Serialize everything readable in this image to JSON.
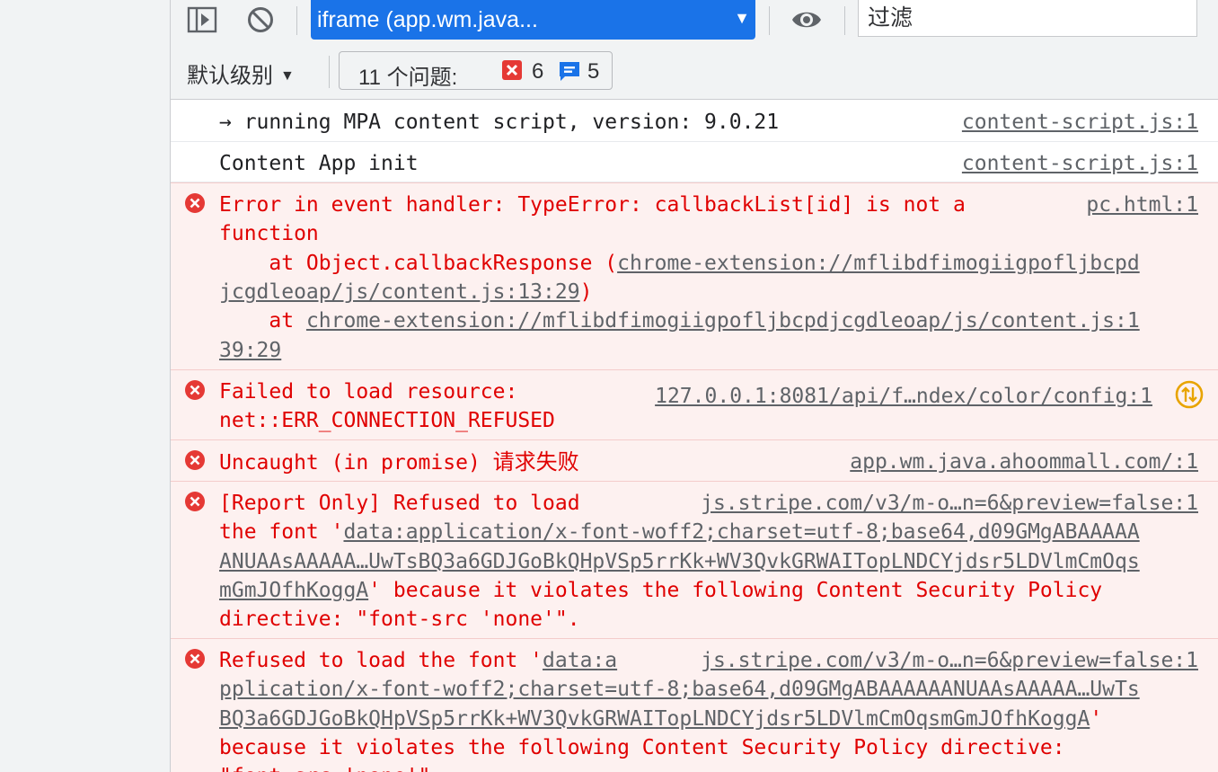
{
  "toolbar": {
    "context_select": "iframe (app.wm.java...",
    "filter_placeholder": "过滤",
    "level_dropdown": "默认级别",
    "issues_label": "11 个问题:",
    "issues_error_count": "6",
    "issues_info_count": "5"
  },
  "console": {
    "m1": {
      "text": "→ running MPA content script, version: 9.0.21",
      "source": "content-script.js:1"
    },
    "m2": {
      "text": "Content App init",
      "source": "content-script.js:1"
    },
    "m3": {
      "line1": "Error in event handler: TypeError: callbackList[id] is not a",
      "line2": "function",
      "line3_prefix": "    at Object.callbackResponse (",
      "line3_link": "chrome-extension://mflibdfimogiigpofljbcpd",
      "line4_link": "jcgdleoap/js/content.js:13:29",
      "line4_suffix": ")",
      "line5_prefix": "    at ",
      "line5_link": "chrome-extension://mflibdfimogiigpofljbcpdjcgdleoap/js/content.js:1",
      "line6_link": "39:29",
      "source": "pc.html:1"
    },
    "m4": {
      "line1": "Failed to load resource:",
      "line2": "net::ERR_CONNECTION_REFUSED",
      "source": "127.0.0.1:8081/api/f…ndex/color/config:1"
    },
    "m5": {
      "text": "Uncaught (in promise) ",
      "text_zh": "请求失败",
      "source": "app.wm.java.ahoommall.com/:1"
    },
    "m6": {
      "line1": "[Report Only] Refused to load",
      "line2_prefix": "the font '",
      "line2_link": "data:application/x-font-woff2;charset=utf-8;base64,d09GMgABAAAAA",
      "line3_link": "ANUAAsAAAAA…UwTsBQ3a6GDJGoBkQHpVSp5rrKk+WV3QvkGRWAITopLNDCYjdsr5LDVlmCmOqs",
      "line4_link": "mGmJOfhKoggA",
      "line4_suffix": "' because it violates the following Content Security Policy",
      "line5": "directive: \"font-src 'none'\".",
      "source": "js.stripe.com/v3/m-o…n=6&preview=false:1"
    },
    "m7": {
      "line1_prefix": "Refused to load the font '",
      "line1_link": "data:a",
      "line2_link": "pplication/x-font-woff2;charset=utf-8;base64,d09GMgABAAAAAANUAAsAAAAA…UwTs",
      "line3_link": "BQ3a6GDJGoBkQHpVSp5rrKk+WV3QvkGRWAITopLNDCYjdsr5LDVlmCmOqsmGmJOfhKoggA",
      "line3_suffix": "'",
      "line4": "because it violates the following Content Security Policy directive:",
      "line5": "\"font-src 'none'\".",
      "source": "js.stripe.com/v3/m-o…n=6&preview=false:1"
    }
  },
  "colors": {
    "accent": "#1a73e8",
    "error": "#e00000",
    "error_bg": "#fdf1f0",
    "warning": "#e8a400"
  }
}
